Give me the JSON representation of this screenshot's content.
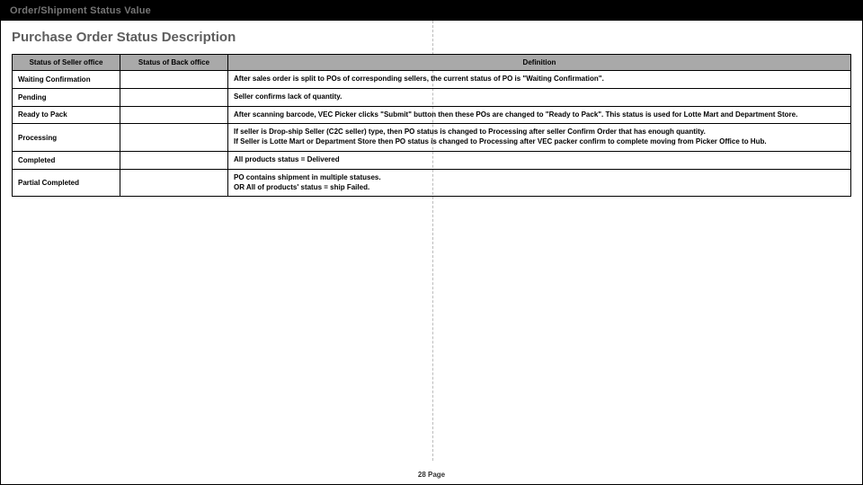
{
  "titlebar": "Order/Shipment Status Value",
  "heading": "Purchase Order Status Description",
  "headers": {
    "seller": "Status of Seller office",
    "back": "Status of Back office",
    "def": "Definition"
  },
  "rows": [
    {
      "seller": "Waiting Confirmation",
      "back": "",
      "def": "After sales order is split to POs of corresponding sellers, the current status of PO is \"Waiting Confirmation\"."
    },
    {
      "seller": "Pending",
      "back": "",
      "def": "Seller confirms lack of quantity."
    },
    {
      "seller": "Ready to Pack",
      "back": "",
      "def": "After scanning barcode, VEC Picker clicks \"Submit\" button then these POs are changed to \"Ready to Pack\". This status is used for Lotte Mart and Department Store."
    },
    {
      "seller": "Processing",
      "back": "",
      "def": "If seller is Drop-ship Seller (C2C seller) type, then PO status is changed to Processing after seller Confirm Order that has enough quantity.\nIf Seller is Lotte Mart or Department Store then PO status is changed to Processing after VEC packer confirm to complete moving from Picker Office to Hub."
    },
    {
      "seller": "Completed",
      "back": "",
      "def": "All products status = Delivered"
    },
    {
      "seller": "Partial Completed",
      "back": "",
      "def": "PO contains shipment in multiple statuses.\nOR All of products' status = ship Failed."
    }
  ],
  "footer": "28 Page"
}
